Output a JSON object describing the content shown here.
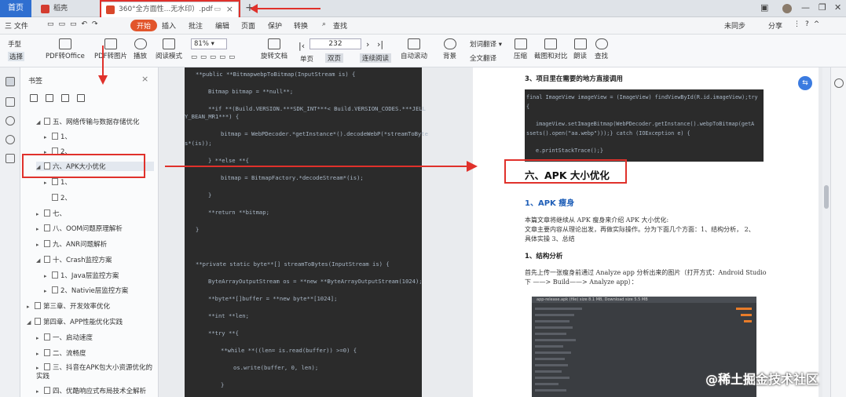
{
  "tabs": {
    "home": "首页",
    "tab1": "稻壳",
    "tab2": "360°全方面性...无水印）.pdf"
  },
  "user": {
    "sync": "未同步",
    "share": "分享"
  },
  "menu": [
    "三 文件",
    "开始",
    "插入",
    "批注",
    "编辑",
    "页面",
    "保护",
    "转换",
    "查找"
  ],
  "toolbar": {
    "hand": "手型",
    "select": "选择",
    "pdf_to_office": "PDF转Office",
    "pdf_to_image": "PDF转图片",
    "play": "播放",
    "read_mode": "阅读模式",
    "zoom": "81%",
    "rotate": "旋转文档",
    "single": "单页",
    "double": "双页",
    "continuous": "连续阅读",
    "auto_scroll": "自动滚动",
    "background": "背景",
    "translate_words": "划词翻译",
    "translate_full": "全文翻译",
    "compress": "压缩",
    "screenshot": "截图和对比",
    "read_aloud": "朗读",
    "find": "查找",
    "page": "232"
  },
  "sidebar": {
    "title": "书签",
    "items": [
      "五、网络传输与数据存储优化",
      "1、",
      "2、",
      "六、APK大小优化",
      "1、",
      "2、",
      "七、",
      "八、OOM问题原理解析",
      "九、ANR问题解析",
      "十、Crash监控方案",
      "1、Java层监控方案",
      "2、Nativie层监控方案",
      "第三章、开发效率优化",
      "第四章、APP性能优化实践",
      "一、启动速度",
      "二、流畅度",
      "三、抖音在APK包大小资源优化的实践",
      "四、优酷响应式布局技术全解析"
    ]
  },
  "code": [
    "**public **BitmapwebpToBitmap(InputStream is) {",
    "Bitmap bitmap = **null**;",
    "**if **(Build.VERSION.***SDK_INT***< Build.VERSION_CODES.***JELL",
    "Y_BEAN_MR1***) {",
    "bitmap = WebPDecoder.*getInstance*().decodeWebP(*streamToByte",
    "s*(is));",
    "} **else **{",
    "bitmap = BitmapFactory.*decodeStream*(is);",
    "}",
    "**return **bitmap;",
    "}",
    "**private static byte**[] streamToBytes(InputStream is) {",
    "ByteArrayOutputStream os = **new **ByteArrayOutputStream(1024);",
    "**byte**[]buffer = **new byte**[1024];",
    "**int **len;",
    "**try **{",
    "**while **((len= is.read(buffer)) >=0) {",
    "os.write(buffer, 0, len);",
    "}"
  ],
  "doc": {
    "section3": "3、项目里在需要的地方直接调用",
    "code_block": [
      "final ImageView imageView = (ImageView) findViewById(R.id.imageView);try",
      "{",
      "imageView.setImageBitmap(WebPDecoder.getInstance().webpToBitmap(getA",
      "ssets().open(\"aa.webp\")));} catch (IOException e) {",
      "e.printStackTrace();}"
    ],
    "heading": "六、APK 大小优化",
    "subheading": "1、APK 瘦身",
    "p1": "本篇文章将继续从 APK 瘦身来介绍 APK 大小优化:",
    "p2": "文章主要内容从理论出发，再做实际操作。分为下面几个方面：1、结构分析，  2、",
    "p3": "具体实操 3、总结",
    "section1": "1、结构分析",
    "p4": "首先上传一张瘦身前通过 Analyze app 分析出来的图片（打开方式：Android Studio",
    "p5": "下 ——> Build——> Analyze app）：",
    "shot_header": "app-release.apk (file) size 8.1 MB, Download size 5.5 MB"
  },
  "watermark": "@稀土掘金技术社区"
}
